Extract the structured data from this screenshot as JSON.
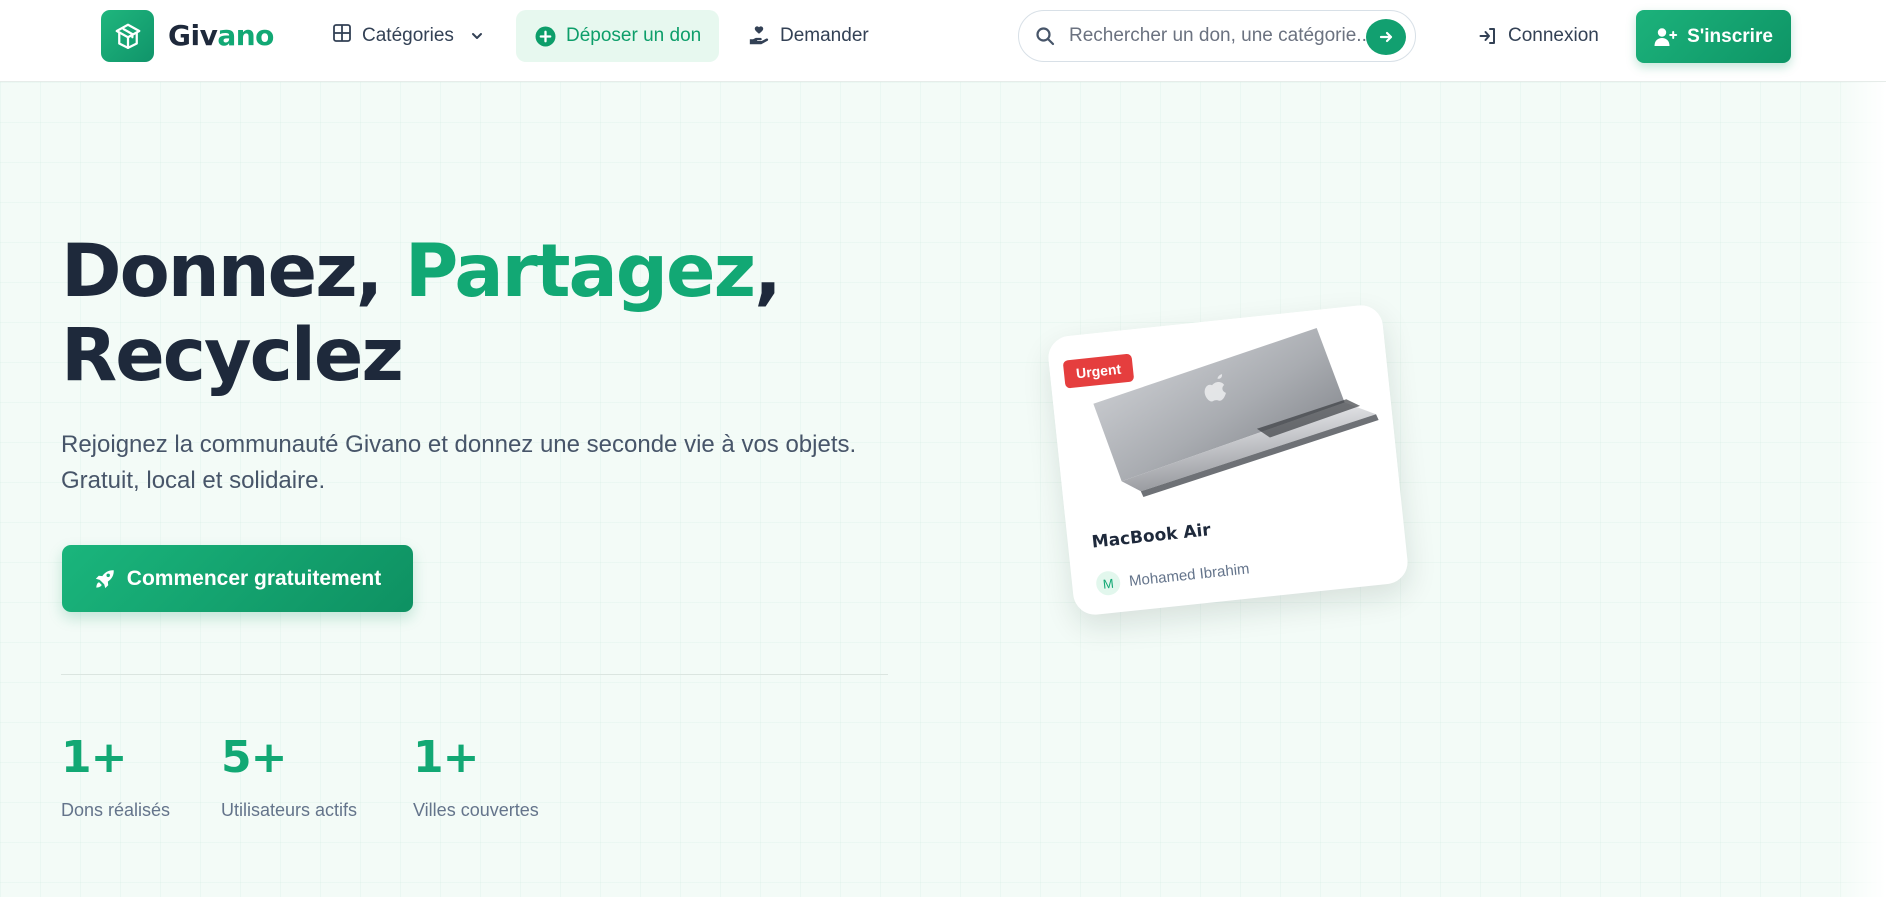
{
  "brand": {
    "name_part1": "Giv",
    "name_part2": "ano",
    "logo_icon": "box-icon"
  },
  "nav": {
    "categories_label": "Catégories",
    "deposer_label": "Déposer un don",
    "demander_label": "Demander",
    "connexion_label": "Connexion",
    "signup_label": "S'inscrire"
  },
  "search": {
    "placeholder": "Rechercher un don, une catégorie...",
    "value": ""
  },
  "hero": {
    "title_part1": "Donnez,",
    "title_accent": "Partagez",
    "title_comma": ",",
    "title_part2": "Recyclez",
    "lead": "Rejoignez la communauté Givano et donnez une seconde vie à vos objets. Gratuit, local et solidaire.",
    "cta_label": "Commencer gratuitement"
  },
  "stats": [
    {
      "value": "1+",
      "label": "Dons réalisés"
    },
    {
      "value": "5+",
      "label": "Utilisateurs actifs"
    },
    {
      "value": "1+",
      "label": "Villes couvertes"
    }
  ],
  "card": {
    "badge": "Urgent",
    "title": "MacBook Air",
    "owner_initial": "M",
    "owner_name": "Mohamed Ibrahim"
  },
  "colors": {
    "brand": "#12a874",
    "urgent": "#e53e3e",
    "text": "#1e293b"
  }
}
